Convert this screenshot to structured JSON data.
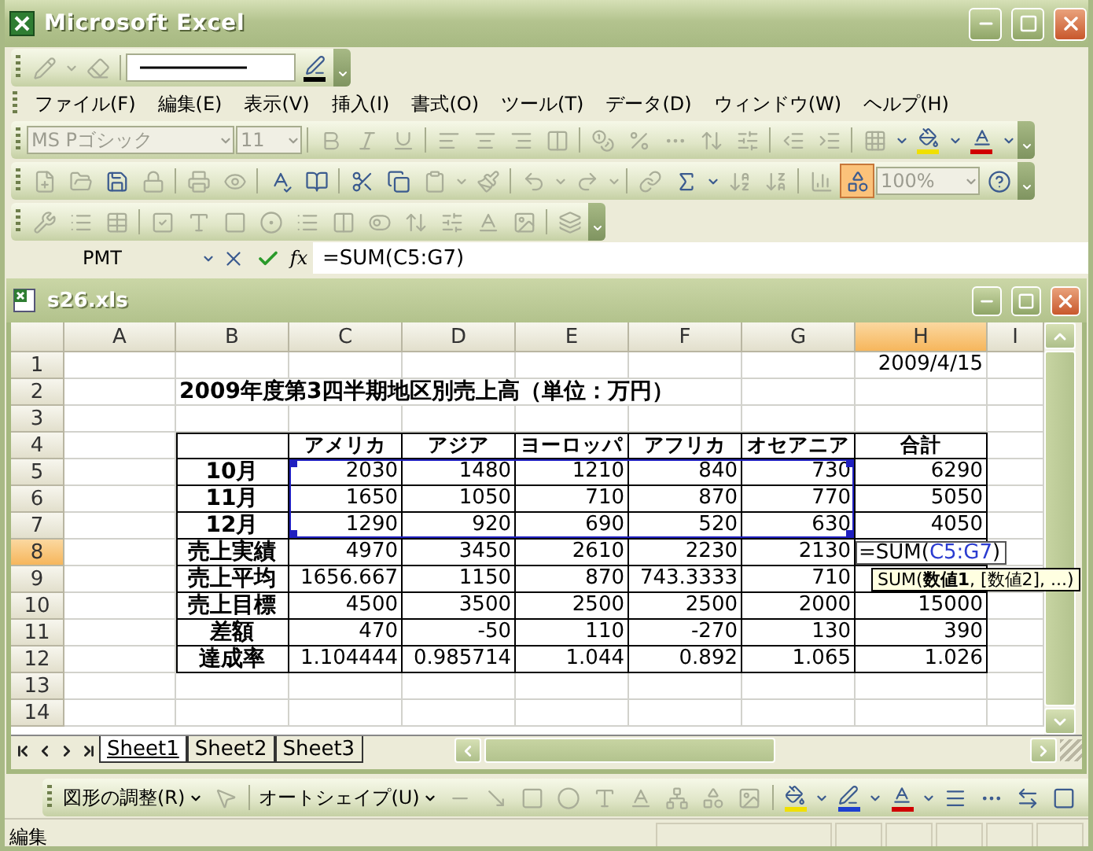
{
  "window": {
    "title": "Microsoft Excel"
  },
  "menu": [
    "ファイル(F)",
    "編集(E)",
    "表示(V)",
    "挿入(I)",
    "書式(O)",
    "ツール(T)",
    "データ(D)",
    "ウィンドウ(W)",
    "ヘルプ(H)"
  ],
  "formatting_toolbar": {
    "font": "MS Pゴシック",
    "size": "11",
    "disabled": true
  },
  "standard_toolbar": {
    "zoom": "100%",
    "zoom_disabled": true,
    "drawing_on": true
  },
  "formula_bar": {
    "name_box": "PMT",
    "fx": "fx",
    "formula": "=SUM(C5:G7)"
  },
  "workbook": {
    "title": "s26.xls",
    "columns": [
      {
        "label": "A",
        "selected": false
      },
      {
        "label": "B",
        "selected": false
      },
      {
        "label": "C",
        "selected": false
      },
      {
        "label": "D",
        "selected": false
      },
      {
        "label": "E",
        "selected": false
      },
      {
        "label": "F",
        "selected": false
      },
      {
        "label": "G",
        "selected": false
      },
      {
        "label": "H",
        "selected": true
      },
      {
        "label": "I",
        "selected": false
      }
    ],
    "rows": [
      {
        "header": "1",
        "selected": false,
        "cells": [
          {
            "kind": "blank"
          },
          {
            "kind": "blank"
          },
          {
            "kind": "blank"
          },
          {
            "kind": "blank"
          },
          {
            "kind": "blank"
          },
          {
            "kind": "blank"
          },
          {
            "kind": "blank"
          },
          {
            "kind": "date",
            "text": "2009/4/15"
          }
        ]
      },
      {
        "header": "2",
        "selected": false,
        "cells": [
          {
            "kind": "blank"
          },
          {
            "kind": "title",
            "text": "2009年度第3四半期地区別売上高（単位：万円）"
          }
        ]
      },
      {
        "header": "3",
        "selected": false
      },
      {
        "header": "4",
        "selected": false,
        "cells": [
          {
            "kind": "blank"
          },
          {
            "kind": "blank",
            "bordered": true
          },
          {
            "kind": "header",
            "text": "アメリカ",
            "bordered": true
          },
          {
            "kind": "header",
            "text": "アジア",
            "bordered": true
          },
          {
            "kind": "header",
            "text": "ヨーロッパ",
            "bordered": true
          },
          {
            "kind": "header",
            "text": "アフリカ",
            "bordered": true
          },
          {
            "kind": "header",
            "text": "オセアニア",
            "bordered": true
          },
          {
            "kind": "header",
            "text": "合計",
            "bordered": true
          }
        ]
      },
      {
        "header": "5",
        "selected": false,
        "cells": [
          {
            "kind": "blank"
          },
          {
            "kind": "label",
            "text": "10月",
            "bordered": true
          },
          {
            "kind": "number",
            "text": "2030",
            "bordered": true
          },
          {
            "kind": "number",
            "text": "1480",
            "bordered": true
          },
          {
            "kind": "number",
            "text": "1210",
            "bordered": true
          },
          {
            "kind": "number",
            "text": "840",
            "bordered": true
          },
          {
            "kind": "number",
            "text": "730",
            "bordered": true
          },
          {
            "kind": "number",
            "text": "6290",
            "bordered": true
          }
        ]
      },
      {
        "header": "6",
        "selected": false,
        "cells": [
          {
            "kind": "blank"
          },
          {
            "kind": "label",
            "text": "11月",
            "bordered": true
          },
          {
            "kind": "number",
            "text": "1650",
            "bordered": true
          },
          {
            "kind": "number",
            "text": "1050",
            "bordered": true
          },
          {
            "kind": "number",
            "text": "710",
            "bordered": true
          },
          {
            "kind": "number",
            "text": "870",
            "bordered": true
          },
          {
            "kind": "number",
            "text": "770",
            "bordered": true
          },
          {
            "kind": "number",
            "text": "5050",
            "bordered": true
          }
        ]
      },
      {
        "header": "7",
        "selected": false,
        "cells": [
          {
            "kind": "blank"
          },
          {
            "kind": "label",
            "text": "12月",
            "bordered": true
          },
          {
            "kind": "number",
            "text": "1290",
            "bordered": true
          },
          {
            "kind": "number",
            "text": "920",
            "bordered": true
          },
          {
            "kind": "number",
            "text": "690",
            "bordered": true
          },
          {
            "kind": "number",
            "text": "520",
            "bordered": true
          },
          {
            "kind": "number",
            "text": "630",
            "bordered": true
          },
          {
            "kind": "number",
            "text": "4050",
            "bordered": true
          }
        ]
      },
      {
        "header": "8",
        "selected": true,
        "cells": [
          {
            "kind": "blank"
          },
          {
            "kind": "label",
            "text": "売上実績",
            "bordered": true
          },
          {
            "kind": "number",
            "text": "4970",
            "bordered": true
          },
          {
            "kind": "number",
            "text": "3450",
            "bordered": true
          },
          {
            "kind": "number",
            "text": "2610",
            "bordered": true
          },
          {
            "kind": "number",
            "text": "2230",
            "bordered": true
          },
          {
            "kind": "number",
            "text": "2130",
            "bordered": true
          },
          {
            "kind": "editing",
            "text": "=SUM(",
            "ref": "C5:G7",
            "suffix": ")",
            "bordered": true
          }
        ]
      },
      {
        "header": "9",
        "selected": false,
        "cells": [
          {
            "kind": "blank"
          },
          {
            "kind": "label",
            "text": "売上平均",
            "bordered": true
          },
          {
            "kind": "number",
            "text": "1656.667",
            "bordered": true
          },
          {
            "kind": "number",
            "text": "1150",
            "bordered": true
          },
          {
            "kind": "number",
            "text": "870",
            "bordered": true
          },
          {
            "kind": "number",
            "text": "743.3333",
            "bordered": true
          },
          {
            "kind": "number",
            "text": "710",
            "bordered": true
          },
          {
            "kind": "blank",
            "bordered": true
          }
        ]
      },
      {
        "header": "10",
        "selected": false,
        "cells": [
          {
            "kind": "blank"
          },
          {
            "kind": "label",
            "text": "売上目標",
            "bordered": true
          },
          {
            "kind": "number",
            "text": "4500",
            "bordered": true
          },
          {
            "kind": "number",
            "text": "3500",
            "bordered": true
          },
          {
            "kind": "number",
            "text": "2500",
            "bordered": true
          },
          {
            "kind": "number",
            "text": "2500",
            "bordered": true
          },
          {
            "kind": "number",
            "text": "2000",
            "bordered": true
          },
          {
            "kind": "number",
            "text": "15000",
            "bordered": true
          }
        ]
      },
      {
        "header": "11",
        "selected": false,
        "cells": [
          {
            "kind": "blank"
          },
          {
            "kind": "label",
            "text": "差額",
            "bordered": true
          },
          {
            "kind": "number",
            "text": "470",
            "bordered": true
          },
          {
            "kind": "number",
            "text": "-50",
            "bordered": true
          },
          {
            "kind": "number",
            "text": "110",
            "bordered": true
          },
          {
            "kind": "number",
            "text": "-270",
            "bordered": true
          },
          {
            "kind": "number",
            "text": "130",
            "bordered": true
          },
          {
            "kind": "number",
            "text": "390",
            "bordered": true
          }
        ]
      },
      {
        "header": "12",
        "selected": false,
        "cells": [
          {
            "kind": "blank"
          },
          {
            "kind": "label",
            "text": "達成率",
            "bordered": true
          },
          {
            "kind": "number",
            "text": "1.104444",
            "bordered": true
          },
          {
            "kind": "number",
            "text": "0.985714",
            "bordered": true
          },
          {
            "kind": "number",
            "text": "1.044",
            "bordered": true
          },
          {
            "kind": "number",
            "text": "0.892",
            "bordered": true
          },
          {
            "kind": "number",
            "text": "1.065",
            "bordered": true
          },
          {
            "kind": "number",
            "text": "1.026",
            "bordered": true
          }
        ]
      },
      {
        "header": "13",
        "selected": false
      },
      {
        "header": "14",
        "selected": false
      }
    ],
    "tooltip": "SUM(**数値1**, [数値2], ...)",
    "sheets": [
      {
        "label": "Sheet1",
        "selected": true
      },
      {
        "label": "Sheet2",
        "selected": false
      },
      {
        "label": "Sheet3",
        "selected": false
      }
    ]
  },
  "drawing_toolbar": {
    "arrange": "図形の調整(R)",
    "autoshapes": "オートシェイプ(U)"
  },
  "status_bar": {
    "mode": "編集"
  }
}
